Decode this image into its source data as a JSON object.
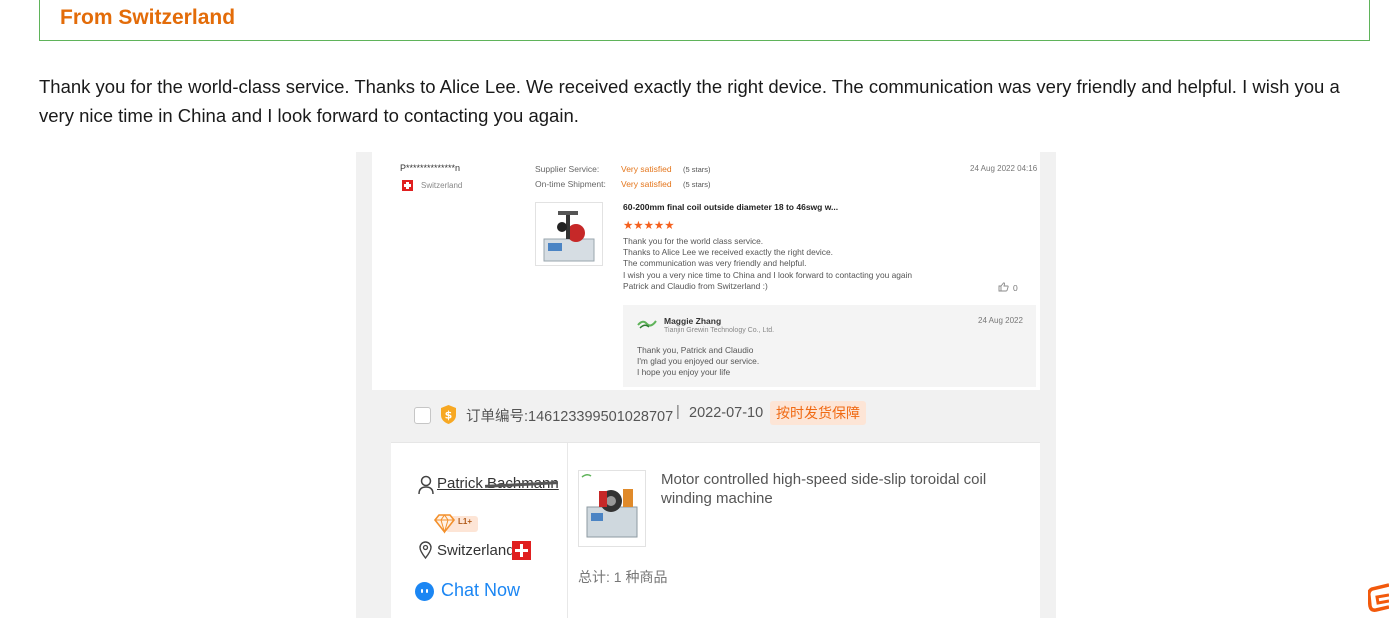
{
  "header": {
    "title": "From Switzerland"
  },
  "testimonial": {
    "text": " Thank you for the world-class service. Thanks to Alice Lee. We received exactly the right device. The communication was very friendly and helpful. I wish you a very nice time in China and I look forward to contacting you again."
  },
  "review": {
    "reviewer": "P**************n",
    "country": "Switzerland",
    "supplier_service_label": "Supplier Service:",
    "supplier_service_value": "Very satisfied",
    "supplier_service_stars": "(5 stars)",
    "shipment_label": "On-time Shipment:",
    "shipment_value": "Very satisfied",
    "shipment_stars": "(5 stars)",
    "date": "24 Aug 2022 04:16",
    "product_title": "60-200mm final coil outside diameter 18 to 46swg w...",
    "stars": "★★★★★",
    "rating": 5,
    "lines": [
      "Thank you for the world class service.",
      "Thanks to Alice Lee we received exactly the right device.",
      "The communication was very friendly and helpful.",
      "I wish you a very nice time to China and I look forward to contacting you again",
      "Patrick and Claudio from Switzerland :)"
    ],
    "likes": "0",
    "reply": {
      "name": "Maggie Zhang",
      "company": "Tianjin Grewin Technology Co., Ltd.",
      "date": "24 Aug 2022",
      "lines": [
        "Thank you, Patrick and Claudio",
        " I'm glad you enjoyed our service.",
        " I hope you enjoy your life"
      ]
    }
  },
  "order": {
    "number": "订单编号:146123399501028707",
    "separator": "|",
    "date": "2022-07-10",
    "guarantee": "按时发货保障"
  },
  "buyer": {
    "name": "Patrick Bachmann",
    "level": "L1+",
    "country": "Switzerland",
    "chat": "Chat Now"
  },
  "product": {
    "title": "Motor controlled high-speed side-slip toroidal coil winding machine",
    "total": "总计: 1 种商品"
  },
  "colors": {
    "accent": "#e36c09",
    "border": "#5fb35a",
    "rating": "#e4761c",
    "link": "#1b86f3"
  }
}
